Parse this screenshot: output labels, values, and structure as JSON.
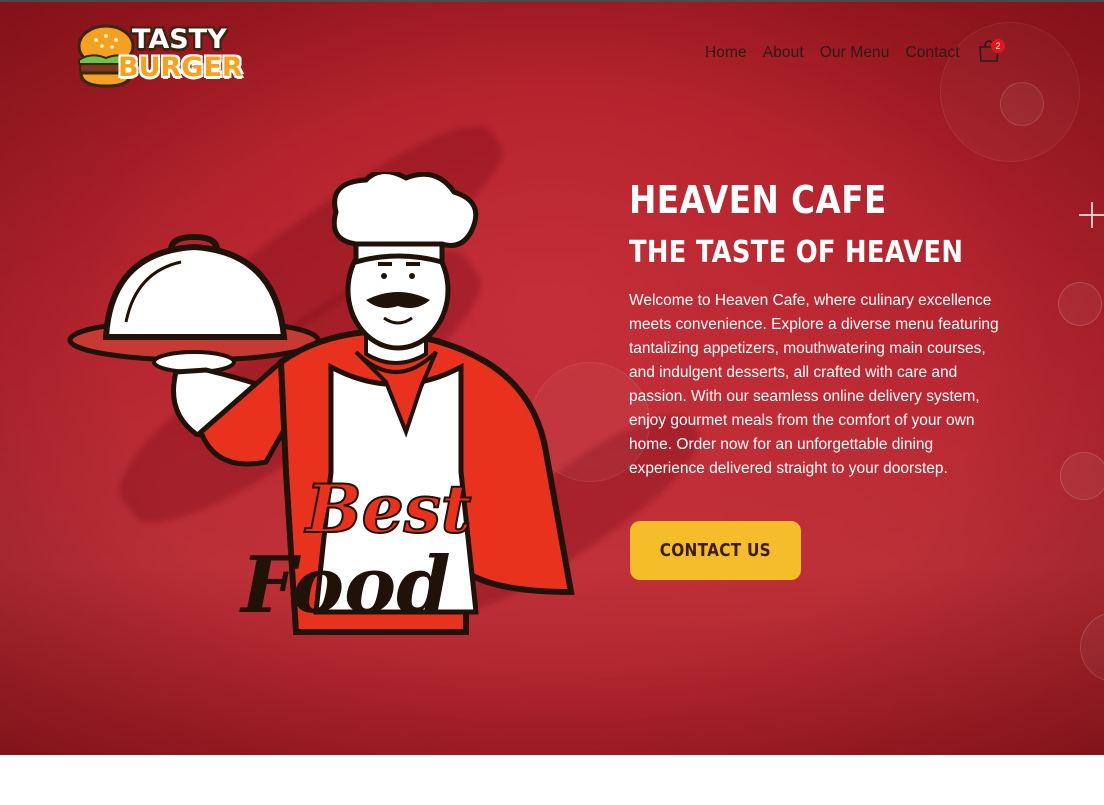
{
  "logo": {
    "line1": "TASTY",
    "line2": "BURGER",
    "icon": "burger-icon"
  },
  "nav": {
    "items": [
      {
        "label": "Home"
      },
      {
        "label": "About"
      },
      {
        "label": "Our Menu"
      },
      {
        "label": "Contact"
      }
    ],
    "cart_icon": "shopping-bag-icon",
    "cart_count": "2"
  },
  "hero": {
    "title": "HEAVEN CAFE",
    "subtitle": "THE TASTE OF HEAVEN",
    "description": "Welcome to Heaven Cafe, where culinary excellence meets convenience. Explore a diverse menu featuring tantalizing appetizers, mouthwatering main courses, and indulgent desserts, all crafted with care and passion. With our seamless online delivery system, enjoy gourmet meals from the comfort of your own home. Order now for an unforgettable dining experience delivered straight to your doorstep.",
    "cta_label": "CONTACT US",
    "illustration": {
      "text_line1": "Best",
      "text_line2": "Food"
    }
  },
  "colors": {
    "hero_bg": "#b5252f",
    "cta_bg": "#f5bd2a",
    "cta_text": "#3a1d10",
    "badge": "#e8131a",
    "logo_orange": "#f7a21b"
  }
}
